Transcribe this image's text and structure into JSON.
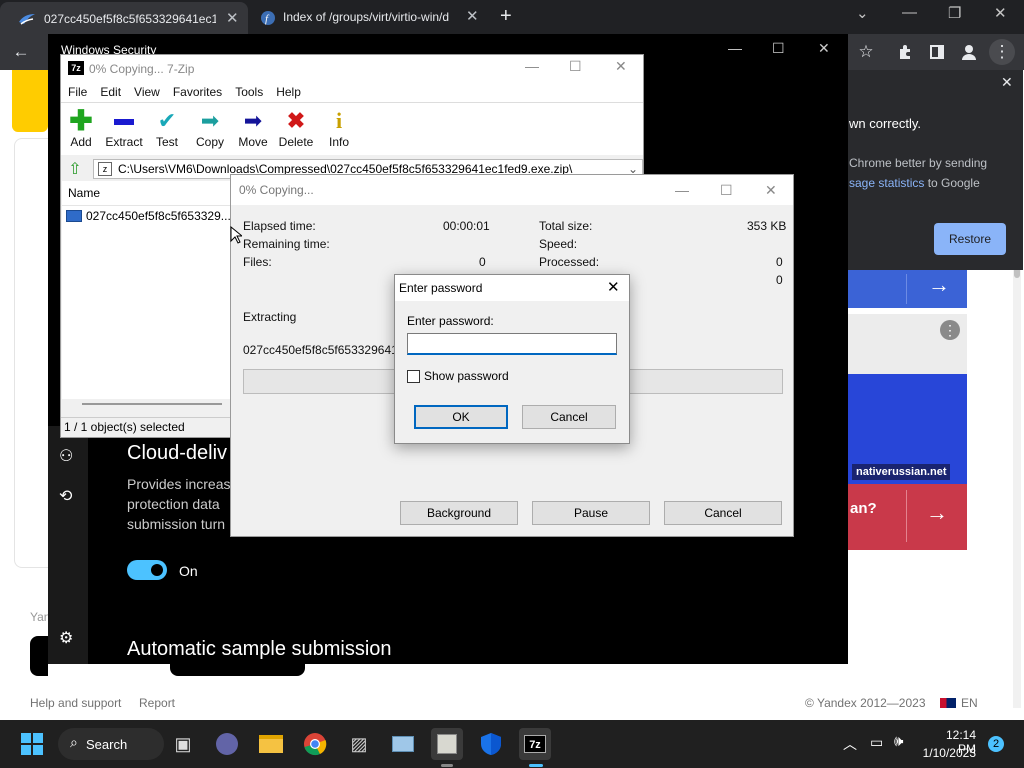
{
  "chrome": {
    "tabs": [
      {
        "title": "027cc450ef5f8c5f653329641ec1fe"
      },
      {
        "title": "Index of /groups/virt/virtio-win/d"
      }
    ],
    "popup": {
      "line1": "wn correctly.",
      "line2": "Chrome better by sending",
      "line3_link": "sage statistics",
      "line3_rest": " to Google",
      "restore_label": "Restore"
    }
  },
  "page": {
    "footer": {
      "help": "Help and support",
      "report": "Report",
      "copyright": "© Yandex 2012—2023",
      "lang": "EN"
    },
    "side_text1": "Yan",
    "ad_badge": "nativerussian.net",
    "ad_text": "an?"
  },
  "winsec": {
    "title": "Windows Security",
    "heading": "Cloud-deliv",
    "desc_lines": [
      "Provides increas",
      "protection data",
      "submission turn"
    ],
    "toggle_label": "On",
    "subheading": "Automatic sample submission"
  },
  "zip": {
    "title": "0% Copying... 7-Zip",
    "menu": [
      "File",
      "Edit",
      "View",
      "Favorites",
      "Tools",
      "Help"
    ],
    "toolbar": [
      {
        "label": "Add",
        "icon": "plus-icon",
        "color": "#1fa51f"
      },
      {
        "label": "Extract",
        "icon": "minus-icon",
        "color": "#1a1ad0"
      },
      {
        "label": "Test",
        "icon": "check-icon",
        "color": "#19a8b8"
      },
      {
        "label": "Copy",
        "icon": "copy-arrow-icon",
        "color": "#1b9e9e"
      },
      {
        "label": "Move",
        "icon": "move-arrow-icon",
        "color": "#141499"
      },
      {
        "label": "Delete",
        "icon": "delete-x-icon",
        "color": "#d01818"
      },
      {
        "label": "Info",
        "icon": "info-icon",
        "color": "#c8a000"
      }
    ],
    "address": "C:\\Users\\VM6\\Downloads\\Compressed\\027cc450ef5f8c5f653329641ec1fed9.exe.zip\\",
    "column_name": "Name",
    "file_name": "027cc450ef5f8c5f653329...",
    "status": "1 / 1 object(s) selected"
  },
  "progress": {
    "title": "0% Copying...",
    "elapsed_label": "Elapsed time:",
    "elapsed_value": "00:00:01",
    "remaining_label": "Remaining time:",
    "files_label": "Files:",
    "files_value": "0",
    "total_size_label": "Total size:",
    "total_size_value": "353 KB",
    "speed_label": "Speed:",
    "processed_label": "Processed:",
    "processed_value": "0",
    "extra_value": "0",
    "extracting_label": "Extracting",
    "extracting_file": "027cc450ef5f8c5f653329641ec",
    "buttons": {
      "background": "Background",
      "pause": "Pause",
      "cancel": "Cancel"
    }
  },
  "password_dialog": {
    "title": "Enter password",
    "field_label": "Enter password:",
    "value": "",
    "show_password_label": "Show password",
    "show_password_checked": false,
    "ok_label": "OK",
    "cancel_label": "Cancel"
  },
  "taskbar": {
    "search_label": "Search",
    "time": "12:14 PM",
    "date": "1/10/2023",
    "notification_count": "2"
  }
}
